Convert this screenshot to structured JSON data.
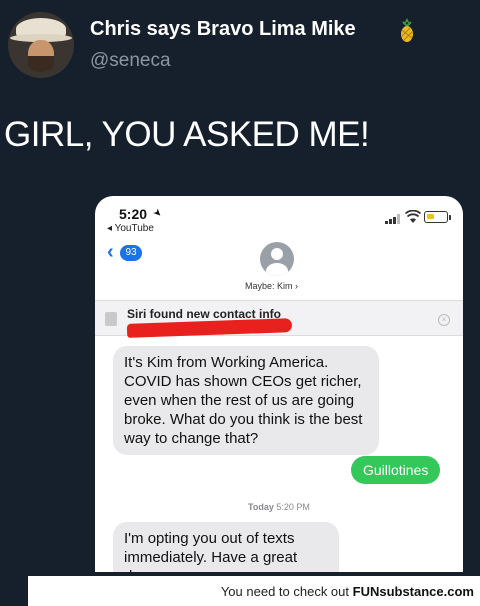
{
  "tweet": {
    "display_name": "Chris says Bravo Lima Mike",
    "handle": "@seneca",
    "text": "GIRL, YOU ASKED ME!",
    "name_emoji_icon": "pineapple-icon"
  },
  "phone": {
    "status_time": "5:20",
    "back_app": "◂ YouTube",
    "unread_badge": "93",
    "contact_name": "Maybe: Kim ›",
    "siri_banner": "Siri found new contact info",
    "messages": [
      {
        "direction": "incoming",
        "text": "It's Kim from Working America. COVID has shown CEOs get richer, even when the rest of us are going broke. What do you think is the best way to change that?"
      },
      {
        "direction": "outgoing",
        "text": "Guillotines"
      },
      {
        "direction": "incoming",
        "text": "I'm opting you out of texts immediately. Have a great day."
      }
    ],
    "timestamp_day": "Today",
    "timestamp_time": "5:20 PM",
    "colors": {
      "ios_blue": "#1a73e8",
      "sent_green": "#34c759",
      "received_gray": "#e9e9eb",
      "redaction": "#e8211e"
    }
  },
  "footer": {
    "prefix": "You need to check out ",
    "brand_fun": "FUN",
    "brand_rest": "substance.com"
  },
  "colors": {
    "background": "#16202c"
  }
}
